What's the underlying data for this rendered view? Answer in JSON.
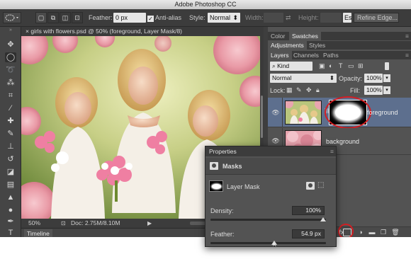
{
  "window": {
    "title": "Adobe Photoshop CC"
  },
  "options_bar": {
    "feather_label": "Feather:",
    "feather_value": "0 px",
    "antialias_label": "Anti-alias",
    "style_label": "Style:",
    "style_value": "Normal",
    "width_label": "Width:",
    "height_label": "Height:",
    "refine_edge_label": "Refine Edge..."
  },
  "document": {
    "tab_title": "girls with flowers.psd @ 50% (foreground, Layer Mask/8)",
    "close_glyph": "×",
    "zoom": "50%",
    "doc_size": "Doc: 2.75M/8.10M"
  },
  "timeline": {
    "label": "Timeline"
  },
  "panels": {
    "group1_tabs": [
      "Color",
      "Swatches"
    ],
    "group2_tabs": [
      "Adjustments",
      "Styles"
    ],
    "group3_tabs": [
      "Layers",
      "Channels",
      "Paths"
    ],
    "layers": {
      "filter_kind": "Kind",
      "blend_mode": "Normal",
      "opacity_label": "Opacity:",
      "opacity_value": "100%",
      "lock_label": "Lock:",
      "fill_label": "Fill:",
      "fill_value": "100%",
      "items": [
        {
          "name": "foreground"
        },
        {
          "name": "background"
        }
      ]
    }
  },
  "properties": {
    "panel_title": "Properties",
    "section_title": "Masks",
    "mask_label": "Layer Mask",
    "density_label": "Density:",
    "density_value": "100%",
    "density_level": 1.0,
    "feather_label": "Feather:",
    "feather_value": "54.9 px",
    "feather_level": 0.55
  },
  "colors": {
    "highlight_ring": "#d21e23",
    "panel_bg": "#535353",
    "selected_layer": "#5d6f8e"
  }
}
